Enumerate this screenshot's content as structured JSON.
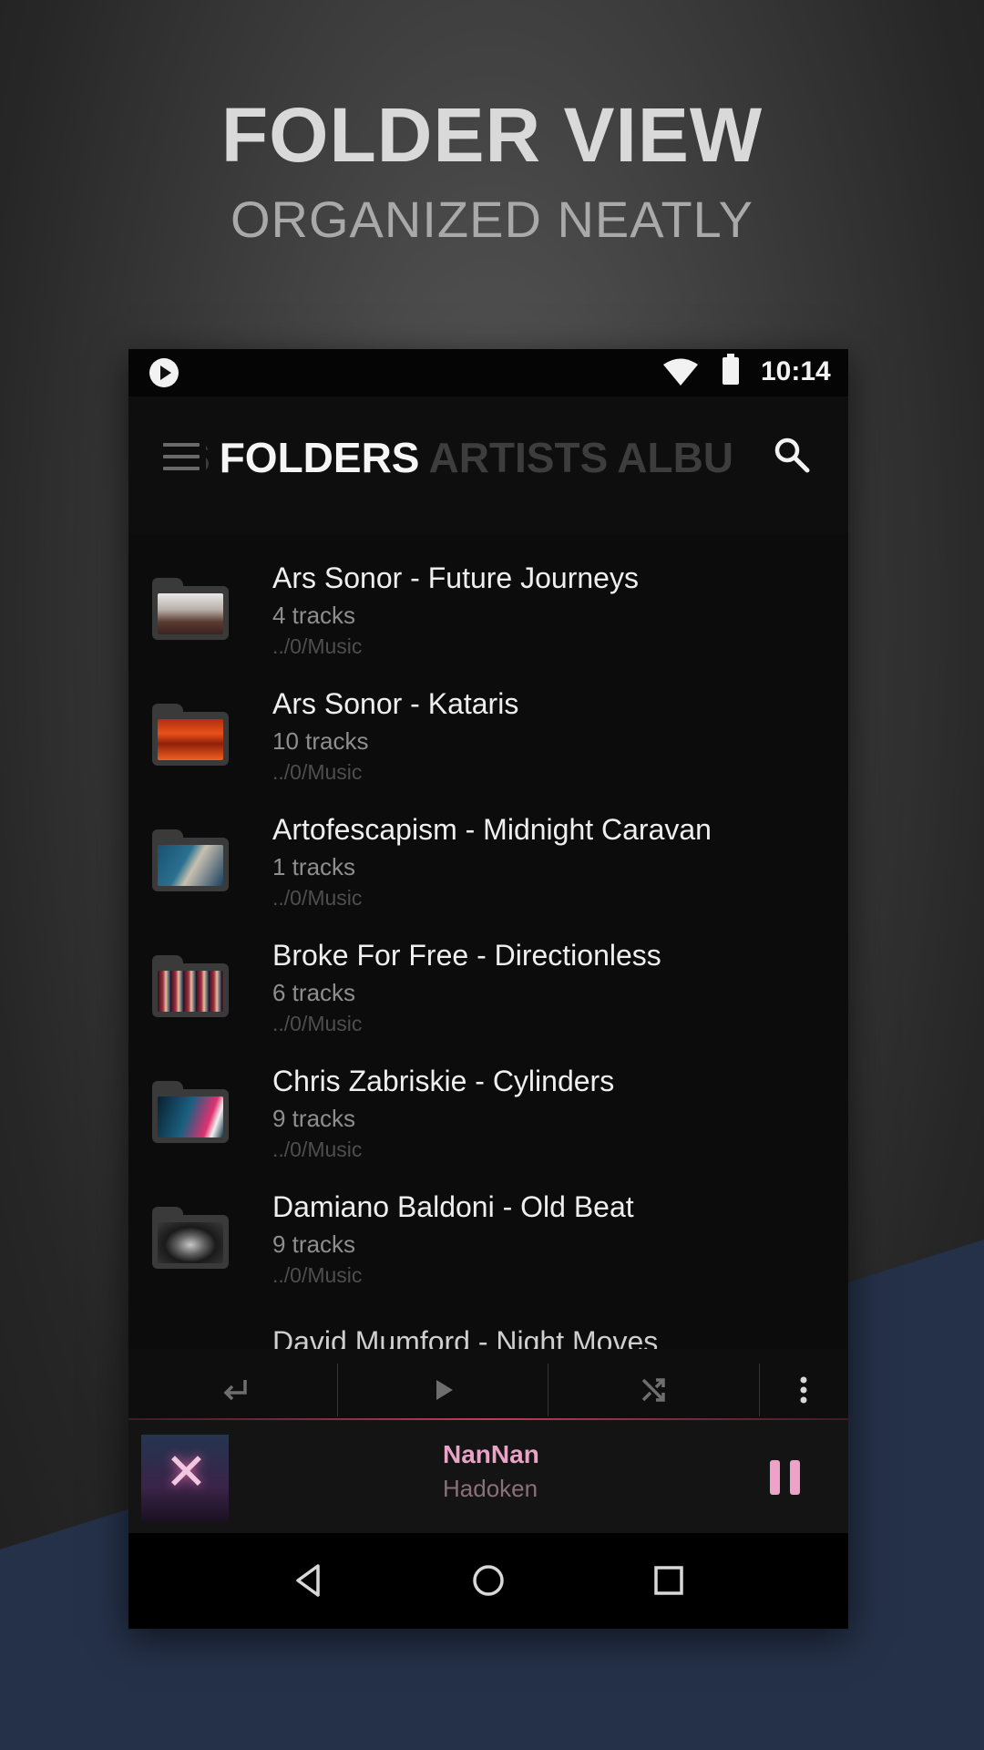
{
  "hero": {
    "title": "FOLDER VIEW",
    "subtitle": "ORGANIZED NEATLY"
  },
  "status_bar": {
    "time": "10:14",
    "icons": [
      "app-logo-icon",
      "wifi-icon",
      "battery-icon"
    ]
  },
  "app_bar": {
    "tabs": [
      {
        "label": "S",
        "active": false
      },
      {
        "label": "FOLDERS",
        "active": true
      },
      {
        "label": "ARTISTS",
        "active": false
      },
      {
        "label": "ALBU",
        "active": false
      }
    ],
    "icons": [
      "menu-icon",
      "search-icon"
    ]
  },
  "folders": [
    {
      "title": "Ars Sonor - Future Journeys",
      "tracks": "4 tracks",
      "path": "../0/Music"
    },
    {
      "title": "Ars Sonor - Kataris",
      "tracks": "10 tracks",
      "path": "../0/Music"
    },
    {
      "title": "Artofescapism - Midnight Caravan",
      "tracks": "1 tracks",
      "path": "../0/Music"
    },
    {
      "title": "Broke For Free - Directionless",
      "tracks": "6 tracks",
      "path": "../0/Music"
    },
    {
      "title": "Chris Zabriskie - Cylinders",
      "tracks": "9 tracks",
      "path": "../0/Music"
    },
    {
      "title": "Damiano Baldoni - Old Beat",
      "tracks": "9 tracks",
      "path": "../0/Music"
    }
  ],
  "peek_row": {
    "title": "David Mumford - Night Moves"
  },
  "action_bar": {
    "icons": [
      "return-icon",
      "play-icon",
      "shuffle-icon",
      "more-vert-icon"
    ]
  },
  "now_playing": {
    "title": "NanNan",
    "artist": "Hadoken",
    "icons": [
      "album-art",
      "pause-icon"
    ]
  },
  "nav_bar": {
    "icons": [
      "back-icon",
      "home-icon",
      "recents-icon"
    ]
  },
  "colors": {
    "accent": "#e8a3c6",
    "progress": "#c63a5a",
    "background_blue": "#253149"
  }
}
